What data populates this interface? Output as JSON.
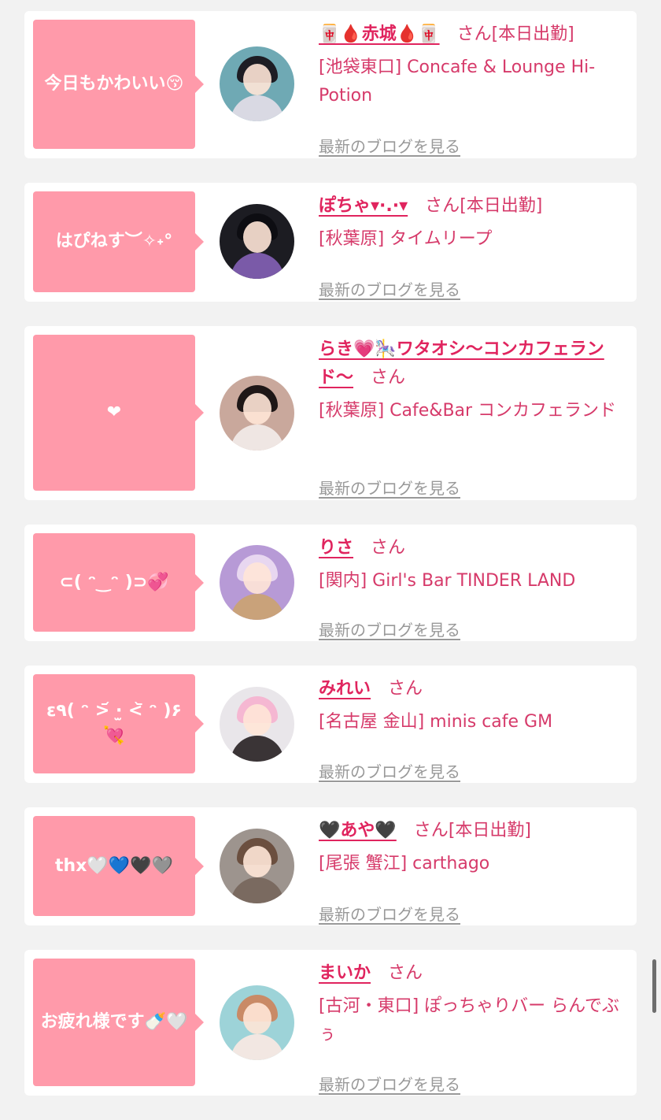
{
  "cards": [
    {
      "bubble_text": "今日もかわいい😚",
      "name": "🀄🩸赤城🩸🀄",
      "honorific": "さん",
      "status": "[本日出勤]",
      "shop": "[池袋東口] Concafe & Lounge Hi-Potion",
      "blog_link": "最新のブログを見る",
      "avatar_colors": {
        "bg": "#6fa9b4",
        "hair": "#1d1d24",
        "body": "#d9d9e3"
      }
    },
    {
      "bubble_text": "はぴねす︶✧˖°",
      "name": "ぽちゃ▾·.·▾",
      "honorific": "さん",
      "status": "[本日出勤]",
      "shop": "[秋葉原] タイムリープ",
      "blog_link": "最新のブログを見る",
      "avatar_colors": {
        "bg": "#1c1c22",
        "hair": "#0d0d12",
        "body": "#7a5aa8"
      }
    },
    {
      "bubble_text": "❤",
      "name": "らき💗🎠ワタオシ〜コンカフェランド〜",
      "honorific": "さん",
      "status": "",
      "shop": "[秋葉原] Cafe&Bar コンカフェランド",
      "blog_link": "最新のブログを見る",
      "avatar_colors": {
        "bg": "#c9a89c",
        "hair": "#1e1717",
        "body": "#efe6e3"
      }
    },
    {
      "bubble_text": "⊂( ᵔ‿ᵔ )⊃💞",
      "name": "りさ",
      "honorific": "さん",
      "status": "",
      "shop": "[関内] Girl's Bar TINDER LAND",
      "blog_link": "最新のブログを見る",
      "avatar_colors": {
        "bg": "#b79ad6",
        "hair": "#e8d7f0",
        "body": "#c9a27a"
      }
    },
    {
      "bubble_text": "ε٩( ᵔ >᷄ ·̫ <᷅ ᵔ )۶ 💘",
      "name": "みれい",
      "honorific": "さん",
      "status": "",
      "shop": "[名古屋 金山] minis cafe GM",
      "blog_link": "最新のブログを見る",
      "avatar_colors": {
        "bg": "#e9e6ea",
        "hair": "#f5b7d2",
        "body": "#3a3436"
      }
    },
    {
      "bubble_text": "thx🤍💙🖤🩶",
      "name": "🖤あや🖤",
      "honorific": "さん",
      "status": "[本日出勤]",
      "shop": "[尾張 蟹江] carthago",
      "blog_link": "最新のブログを見る",
      "avatar_colors": {
        "bg": "#9d948e",
        "hair": "#6b4f3f",
        "body": "#7a6a60"
      }
    },
    {
      "bubble_text": "お疲れ様です🍼🤍",
      "name": "まいか",
      "honorific": "さん",
      "status": "",
      "shop": "[古河・東口] ぽっちゃりバー らんでぶぅ",
      "blog_link": "最新のブログを見る",
      "avatar_colors": {
        "bg": "#9dd3d8",
        "hair": "#c98a66",
        "body": "#f2e7e2"
      }
    }
  ]
}
